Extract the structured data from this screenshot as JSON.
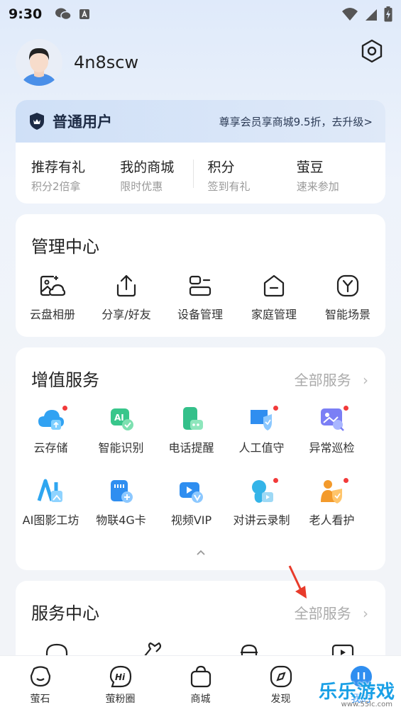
{
  "status_bar": {
    "time": "9:30",
    "icons": [
      "wechat-icon",
      "a-notify-icon",
      "wifi-icon",
      "signal-icon",
      "battery-icon"
    ]
  },
  "profile": {
    "username": "4n8scw",
    "settings_icon": "settings-hexagon-icon"
  },
  "member": {
    "title": "普通用户",
    "upgrade_text": "尊享会员享商城9.5折，去升级>",
    "items": [
      {
        "title": "推荐有礼",
        "sub": "积分2倍拿"
      },
      {
        "title": "我的商城",
        "sub": "限时优惠"
      },
      {
        "title": "积分",
        "sub": "签到有礼"
      },
      {
        "title": "萤豆",
        "sub": "速来参加"
      }
    ]
  },
  "management": {
    "title": "管理中心",
    "items": [
      {
        "label": "云盘相册",
        "icon": "cloud-album-icon"
      },
      {
        "label": "分享/好友",
        "icon": "share-icon"
      },
      {
        "label": "设备管理",
        "icon": "device-manage-icon"
      },
      {
        "label": "家庭管理",
        "icon": "home-icon"
      },
      {
        "label": "智能场景",
        "icon": "smart-scene-icon"
      }
    ]
  },
  "value_services": {
    "title": "增值服务",
    "more": "全部服务",
    "row1": [
      {
        "label": "云存储",
        "icon": "cloud-storage-icon",
        "dot": true
      },
      {
        "label": "智能识别",
        "icon": "ai-recognition-icon",
        "dot": false
      },
      {
        "label": "电话提醒",
        "icon": "phone-reminder-icon",
        "dot": false
      },
      {
        "label": "人工值守",
        "icon": "guard-icon",
        "dot": true
      },
      {
        "label": "异常巡检",
        "icon": "inspection-icon",
        "dot": true
      }
    ],
    "row2": [
      {
        "label": "AI图影工坊",
        "icon": "ai-studio-icon",
        "dot": false
      },
      {
        "label": "物联4G卡",
        "icon": "sim-card-icon",
        "dot": false
      },
      {
        "label": "视频VIP",
        "icon": "video-vip-icon",
        "dot": false
      },
      {
        "label": "对讲云录制",
        "icon": "intercom-record-icon",
        "dot": true
      },
      {
        "label": "老人看护",
        "icon": "elder-care-icon",
        "dot": true
      }
    ]
  },
  "service_center": {
    "title": "服务中心",
    "more": "全部服务"
  },
  "tabbar": [
    {
      "label": "萤石",
      "icon": "ezviz-icon"
    },
    {
      "label": "萤粉圈",
      "icon": "hi-circle-icon"
    },
    {
      "label": "商城",
      "icon": "shop-bag-icon"
    },
    {
      "label": "发现",
      "icon": "discover-icon"
    },
    {
      "label": "我的",
      "icon": "profile-icon"
    }
  ],
  "watermark": {
    "text": "乐乐游戏",
    "url": "www.55lc.com"
  },
  "colors": {
    "accent_blue": "#2f8ef0",
    "red_dot": "#f23a3a",
    "member_bg": "#cfe0f7"
  }
}
